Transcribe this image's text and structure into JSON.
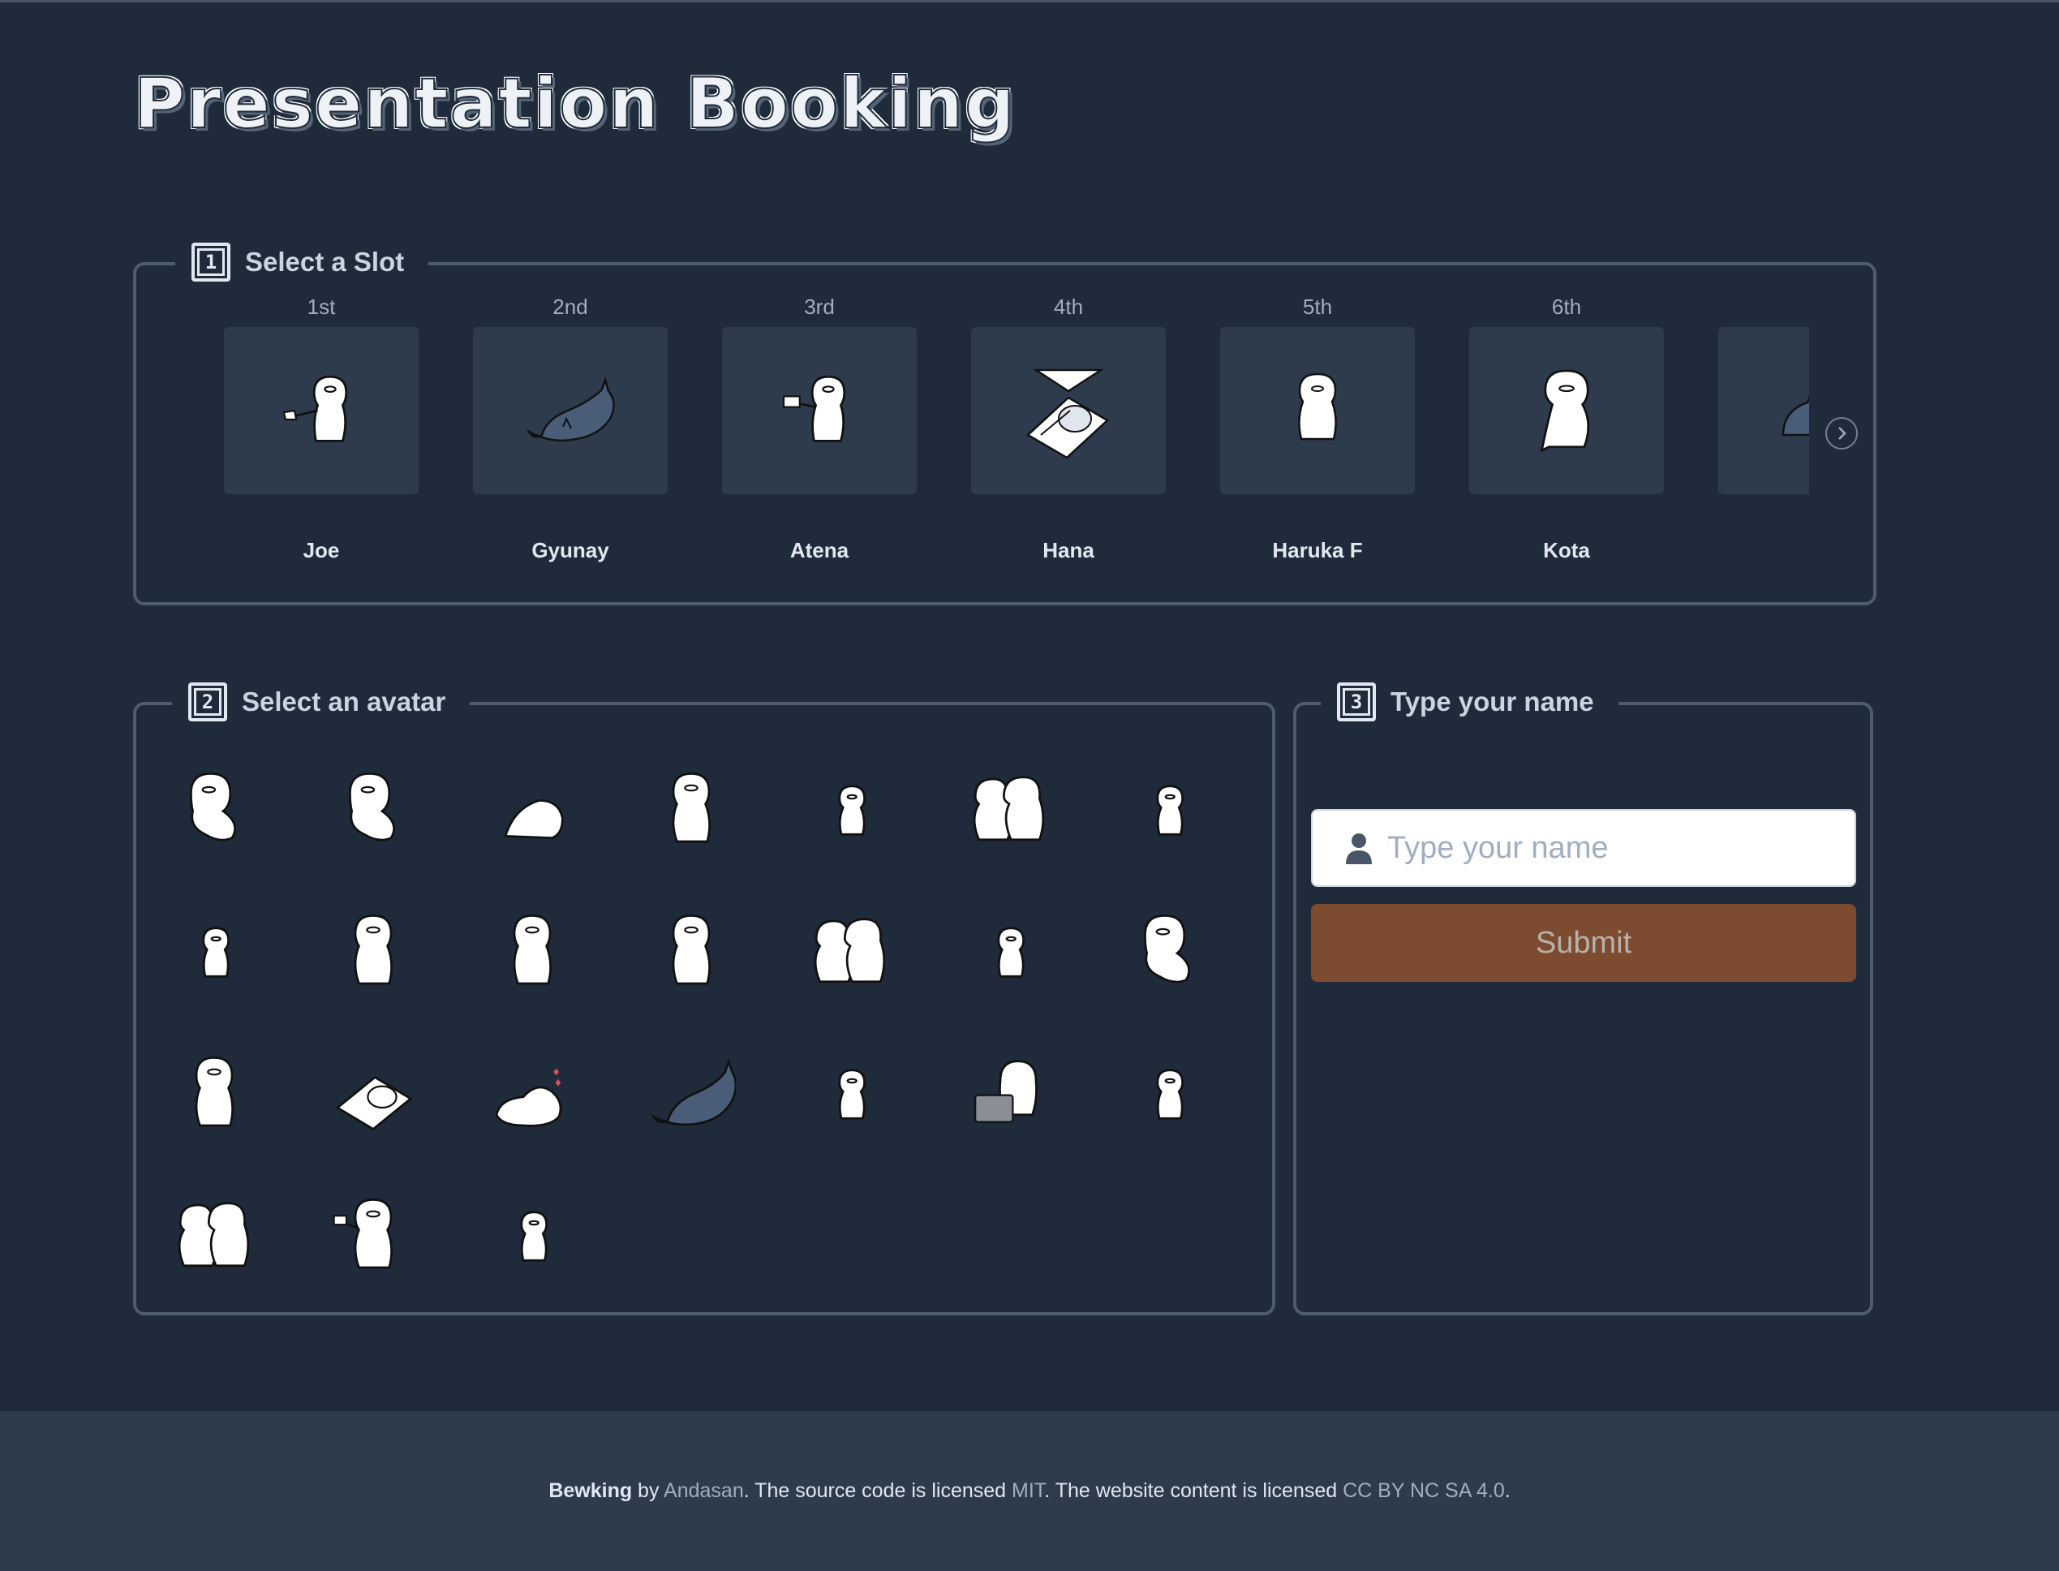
{
  "title": "Presentation Booking",
  "steps": {
    "slot": {
      "number": "1",
      "label": "Select a Slot"
    },
    "avatar": {
      "number": "2",
      "label": "Select an avatar"
    },
    "name": {
      "number": "3",
      "label": "Type your name"
    }
  },
  "slots": [
    {
      "ordinal": "1st",
      "name": "Joe",
      "avatar": "ghost-waving-flag"
    },
    {
      "ordinal": "2nd",
      "name": "Gyunay",
      "avatar": "cat-lying"
    },
    {
      "ordinal": "3rd",
      "name": "Atena",
      "avatar": "ghost-waving-flag"
    },
    {
      "ordinal": "4th",
      "name": "Hana",
      "avatar": "ghost-in-bed"
    },
    {
      "ordinal": "5th",
      "name": "Haruka F",
      "avatar": "ghost-standing"
    },
    {
      "ordinal": "6th",
      "name": "Kota",
      "avatar": "ghost-standing"
    },
    {
      "ordinal": "",
      "name": "",
      "avatar": "cat-lying"
    }
  ],
  "name_form": {
    "placeholder": "Type your name",
    "value": "",
    "submit_label": "Submit"
  },
  "footer": {
    "app": "Bewking",
    "by": " by ",
    "author": "Andasan",
    "t1": ". The source code is licensed ",
    "code_license": "MIT",
    "t2": ". The website content is licensed ",
    "content_license": "CC BY NC SA 4.0",
    "t3": "."
  },
  "colors": {
    "background": "#1f2b3a",
    "panel_border": "#4e5d6e",
    "card": "#2d3b4d",
    "submit": "#7d4b30",
    "footer": "#2d3b4d"
  }
}
